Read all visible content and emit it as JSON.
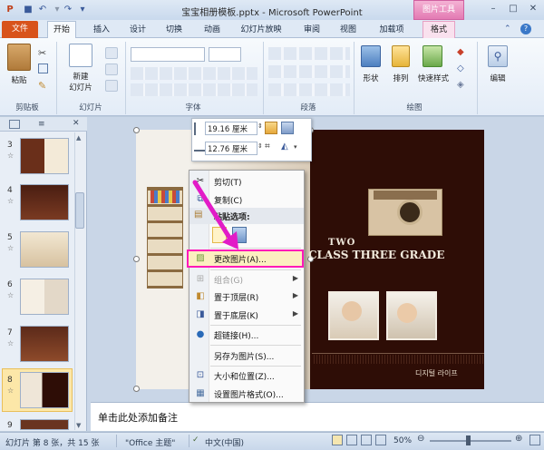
{
  "window": {
    "title": "宝宝相册模板.pptx - Microsoft PowerPoint",
    "contextual_tab_group": "图片工具",
    "qat_icons": [
      "powerpoint-logo-icon",
      "save-icon",
      "undo-icon",
      "redo-icon",
      "customize-qat-icon"
    ],
    "buttons": [
      "minimize-icon",
      "maximize-icon",
      "close-icon"
    ]
  },
  "tabs": {
    "file": "文件",
    "home": "开始",
    "insert": "插入",
    "design": "设计",
    "transitions": "切换",
    "animations": "动画",
    "slideshow": "幻灯片放映",
    "review": "审阅",
    "view": "视图",
    "addins": "加载项",
    "format": "格式"
  },
  "ribbon": {
    "paste": "粘贴",
    "new_slide_line1": "新建",
    "new_slide_line2": "幻灯片",
    "shapes": "形状",
    "arrange": "排列",
    "quick_styles": "快速样式",
    "editing": "编辑",
    "groups": {
      "clipboard": "剪贴板",
      "slides": "幻灯片",
      "font": "字体",
      "paragraph": "段落",
      "drawing": "绘图"
    }
  },
  "panel": {
    "slides": [
      {
        "num": "3"
      },
      {
        "num": "4"
      },
      {
        "num": "5"
      },
      {
        "num": "6"
      },
      {
        "num": "7"
      },
      {
        "num": "8"
      },
      {
        "num": "9"
      }
    ],
    "star": "☆"
  },
  "slide": {
    "heading_line1": "TWO",
    "heading_line2": "CLASS THREE GRADE",
    "footer_text": "디지털 라이프"
  },
  "mini_toolbar": {
    "height_value": "19.16 厘米",
    "width_value": "12.76 厘米"
  },
  "context_menu": {
    "items": [
      {
        "label": "剪切(T)",
        "icon": "scissors-icon"
      },
      {
        "label": "复制(C)",
        "icon": "copy-icon"
      },
      {
        "label": "粘贴选项:",
        "icon": "paste-icon"
      },
      {
        "label": "更改图片(A)...",
        "icon": "change-picture-icon"
      },
      {
        "label": "组合(G)",
        "icon": "group-icon"
      },
      {
        "label": "置于顶层(R)",
        "icon": "bring-to-front-icon"
      },
      {
        "label": "置于底层(K)",
        "icon": "send-to-back-icon"
      },
      {
        "label": "超链接(H)...",
        "icon": "hyperlink-icon"
      },
      {
        "label": "另存为图片(S)...",
        "icon": "save-as-picture-icon"
      },
      {
        "label": "大小和位置(Z)...",
        "icon": "size-position-icon"
      },
      {
        "label": "设置图片格式(O)...",
        "icon": "format-picture-icon"
      }
    ]
  },
  "notes": {
    "placeholder": "单击此处添加备注"
  },
  "status": {
    "slide_info": "幻灯片 第 8 张，共 15 张",
    "theme": "\"Office 主题\"",
    "language": "中文(中国)",
    "zoom": "50%"
  },
  "colors": {
    "accent_file": "#d8531b",
    "highlight": "#ff19b8",
    "slide_bg": "#2e0d06",
    "arrow": "#e21bc7"
  }
}
